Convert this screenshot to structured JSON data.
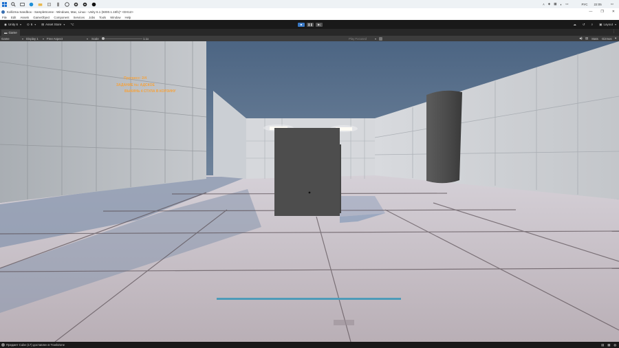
{
  "taskbar": {
    "icons": [
      "windows-start-icon",
      "search-icon",
      "task-view-icon",
      "edge-icon",
      "explorer-icon",
      "store-icon",
      "app-icon-1",
      "app-icon-2",
      "unity-hub-icon",
      "unity-icon"
    ],
    "lang": "РУС",
    "time": "22:05"
  },
  "window": {
    "title": "Kollizma Sandbox - SampleScene - Windows, Mac, Linux - Unity 6.1 (6000.1.15f1)* <DX12>"
  },
  "menu": {
    "items": [
      "File",
      "Edit",
      "Assets",
      "GameObject",
      "Component",
      "Services",
      "Jobs",
      "Tools",
      "Window",
      "Help"
    ]
  },
  "toolbar": {
    "account": "Unity 6",
    "cloud_label": "6",
    "asset_store": "Asset Store",
    "layout": "Layout"
  },
  "tab": {
    "label": "Game"
  },
  "gamebar": {
    "mode": "Game",
    "display": "Display 1",
    "aspect": "Free Aspect",
    "scale_label": "Scale",
    "scale_value": "1.1x",
    "play_focused": "Play Focused",
    "stats": "Stats",
    "gizmos": "Gizmos"
  },
  "hud": {
    "progress": "Прогресс: 2/4",
    "task": "ЗАДАНИЕ №: АДСКОЕ",
    "objective": "ВЫКИНЬ 4 СТУЛА В КОРЗИНУ"
  },
  "statusbar": {
    "message": "Предмет Cube (17) доставлен в TrashZone"
  },
  "colors": {
    "hud_text": "#f5a23c",
    "editor_dark": "#191919",
    "play_active": "#3a79c5",
    "progress_bar": "#4d9bb8"
  }
}
